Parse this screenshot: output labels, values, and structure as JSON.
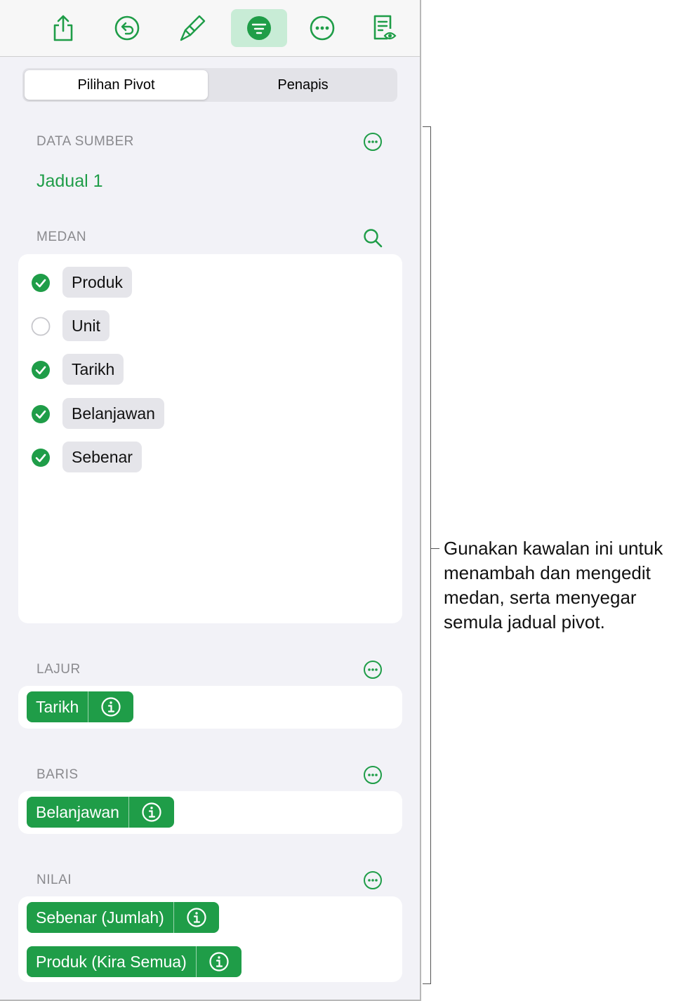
{
  "toolbar": {
    "buttons": [
      "share-icon",
      "undo-icon",
      "paintbrush-icon",
      "organize-icon",
      "more-icon",
      "reading-view-icon"
    ],
    "active": "organize-icon",
    "accent": "#1f9d48"
  },
  "tabs": [
    {
      "label": "Pilihan Pivot",
      "selected": true
    },
    {
      "label": "Penapis",
      "selected": false
    }
  ],
  "source": {
    "header": "DATA SUMBER",
    "table_name": "Jadual 1"
  },
  "fields": {
    "header": "MEDAN",
    "items": [
      {
        "label": "Produk",
        "checked": true
      },
      {
        "label": "Unit",
        "checked": false
      },
      {
        "label": "Tarikh",
        "checked": true
      },
      {
        "label": "Belanjawan",
        "checked": true
      },
      {
        "label": "Sebenar",
        "checked": true
      }
    ]
  },
  "columns": {
    "header": "LAJUR",
    "items": [
      "Tarikh"
    ]
  },
  "rows": {
    "header": "BARIS",
    "items": [
      "Belanjawan"
    ]
  },
  "values": {
    "header": "NILAI",
    "items": [
      "Sebenar (Jumlah)",
      "Produk (Kira Semua)"
    ]
  },
  "callout": {
    "text": "Gunakan kawalan ini untuk menambah dan mengedit medan, serta menyegar semula jadual pivot."
  }
}
